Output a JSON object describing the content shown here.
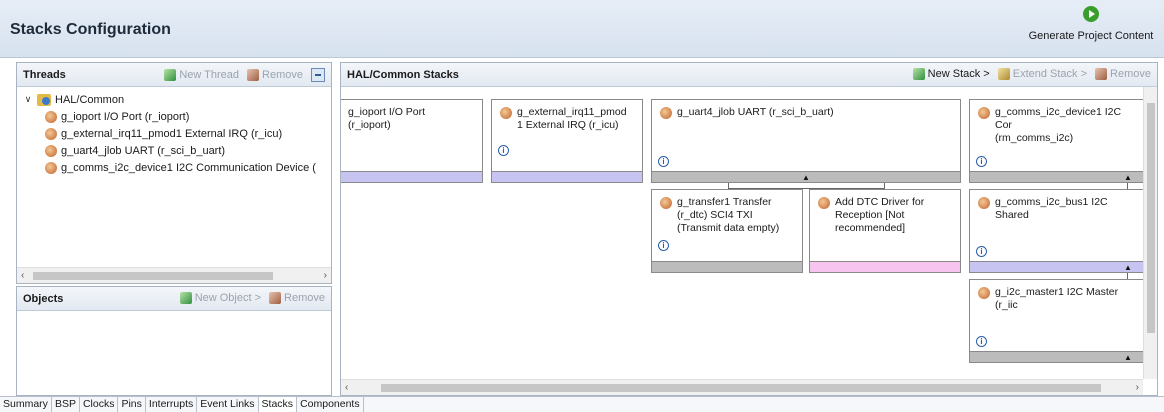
{
  "page": {
    "title": "Stacks Configuration",
    "generate_label": "Generate Project Content"
  },
  "threads": {
    "title": "Threads",
    "new_thread": "New Thread",
    "remove": "Remove",
    "tree": {
      "root": "HAL/Common",
      "items": [
        "g_ioport I/O Port (r_ioport)",
        "g_external_irq11_pmod1 External IRQ (r_icu)",
        "g_uart4_jlob UART (r_sci_b_uart)",
        "g_comms_i2c_device1 I2C Communication Device ("
      ]
    }
  },
  "objects": {
    "title": "Objects",
    "new_object": "New Object >",
    "remove": "Remove"
  },
  "stacks": {
    "title": "HAL/Common Stacks",
    "new_stack": "New Stack >",
    "extend_stack": "Extend Stack >",
    "remove": "Remove",
    "blocks": {
      "ioport": {
        "line1": "g_ioport I/O Port",
        "line2": "(r_ioport)"
      },
      "irq": {
        "line1": "g_external_irq11_pmod",
        "line2": "1 External IRQ (r_icu)"
      },
      "uart": {
        "line1": "g_uart4_jlob UART (r_sci_b_uart)"
      },
      "comms": {
        "line1": "g_comms_i2c_device1 I2C Cor",
        "line2": "(rm_comms_i2c)"
      },
      "transfer": {
        "line1": "g_transfer1 Transfer",
        "line2": "(r_dtc) SCI4 TXI",
        "line3": "(Transmit data empty)"
      },
      "dtc": {
        "line1": "Add DTC Driver for",
        "line2": "Reception [Not",
        "line3": "recommended]"
      },
      "bus": {
        "line1": "g_comms_i2c_bus1 I2C Shared"
      },
      "master": {
        "line1": "g_i2c_master1 I2C Master (r_iic"
      }
    }
  },
  "tabs": [
    "Summary",
    "BSP",
    "Clocks",
    "Pins",
    "Interrupts",
    "Event Links",
    "Stacks",
    "Components"
  ],
  "active_tab": "Stacks",
  "colors": {
    "lavender_bar": "#c7c4f2",
    "pink_bar": "#f6c4ee",
    "gray_bar": "#bcbcbc"
  },
  "icons": {
    "generate": "run-icon",
    "module": "module-icon",
    "info": "info-icon"
  }
}
